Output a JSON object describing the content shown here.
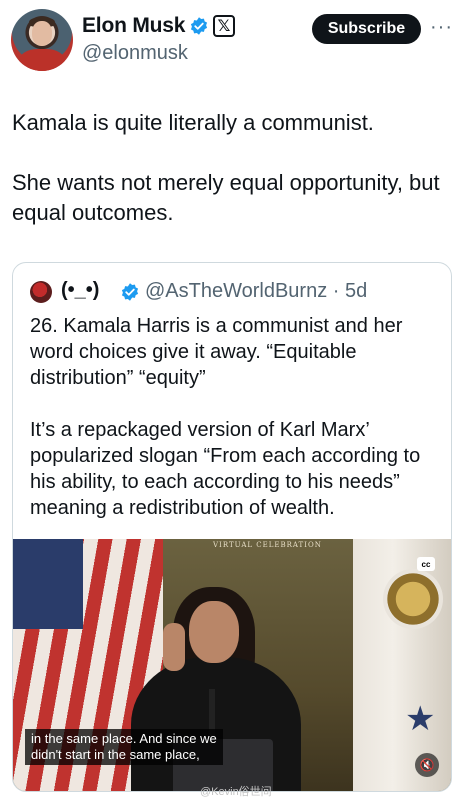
{
  "author": {
    "name": "Elon Musk",
    "handle": "@elonmusk",
    "subscribe_label": "Subscribe",
    "more_icon": "···",
    "x_badge": "𝕏"
  },
  "tweet": {
    "paragraphs": [
      "Kamala is quite literally a communist.",
      "She wants not merely equal opportunity, but equal outcomes."
    ]
  },
  "quoted": {
    "name": "(•_•)",
    "handle_time": "@AsTheWorldBurnz · 5d",
    "paragraphs": [
      "26. Kamala Harris is a communist and her word choices give it away. “Equitable distribution” “equity”",
      "It’s a repackaged version of Karl Marx’ popularized slogan “From each according to his ability, to each according to his needs” meaning a redistribution of wealth."
    ]
  },
  "video": {
    "banner": "VIRTUAL CELEBRATION",
    "cc_label": "cc",
    "caption_line1": "in the same place. And since we",
    "caption_line2": "didn't start in the same place,",
    "mute_icon": "🔇"
  },
  "watermark": "@Kevin俗世间",
  "colors": {
    "verified_blue": "#1d9bf0",
    "text": "#0f1419",
    "secondary": "#536471",
    "border": "#cfd9de"
  }
}
